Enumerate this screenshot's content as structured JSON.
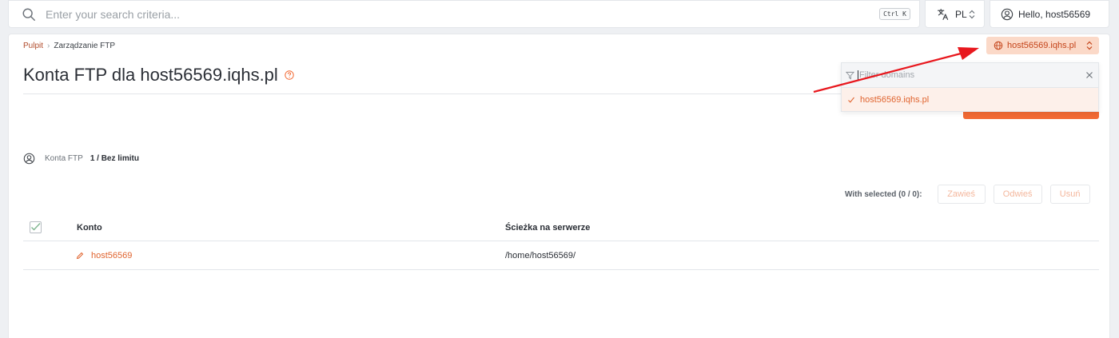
{
  "search": {
    "placeholder": "Enter your search criteria...",
    "shortcut": "Ctrl K"
  },
  "language": {
    "label": "PL"
  },
  "user": {
    "greeting": "Hello, host56569"
  },
  "breadcrumb": {
    "home": "Pulpit",
    "current": "Zarządzanie FTP"
  },
  "domain_selector": {
    "label": "host56569.iqhs.pl"
  },
  "page": {
    "title": "Konta FTP dla host56569.iqhs.pl"
  },
  "dropdown": {
    "filter_placeholder": "Filter domains",
    "items": [
      {
        "label": "host56569.iqhs.pl",
        "selected": true
      }
    ]
  },
  "stats": {
    "label": "Konta FTP",
    "value": "1 / Bez limitu"
  },
  "bulk_actions": {
    "label": "With selected (0 / 0):",
    "buttons": [
      "Zawieś",
      "Odwieś",
      "Usuń"
    ]
  },
  "table": {
    "headers": [
      "Konto",
      "Ścieżka na serwerze"
    ],
    "rows": [
      {
        "account": "host56569",
        "path": "/home/host56569/"
      }
    ]
  },
  "colors": {
    "accent": "#f26a34",
    "accent_light": "#fbd9c8",
    "annotation_arrow": "#e8181e"
  }
}
